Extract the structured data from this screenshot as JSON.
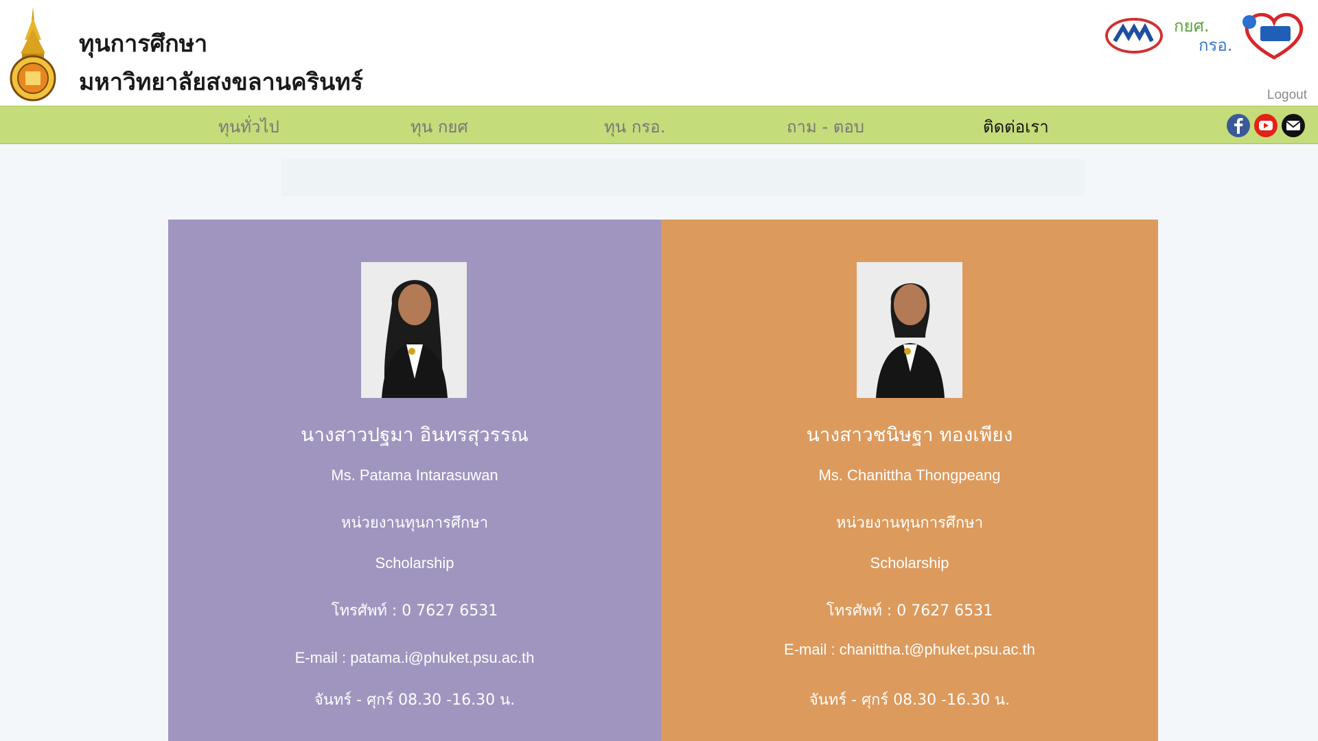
{
  "header": {
    "title_line1": "ทุนการศึกษา",
    "title_line2": "มหาวิทยาลัยสงขลานครินทร์",
    "logout_label": "Logout",
    "partner_text_1": "กยศ.",
    "partner_text_2": "กรอ."
  },
  "nav": {
    "items": [
      {
        "label": "ทุนทั่วไป"
      },
      {
        "label": "ทุน กยศ"
      },
      {
        "label": "ทุน กรอ."
      },
      {
        "label": "ถาม - ตอบ"
      },
      {
        "label": "ติดต่อเรา"
      }
    ],
    "social_icons": [
      "facebook-icon",
      "youtube-icon",
      "email-icon"
    ]
  },
  "contacts": [
    {
      "name_th": "นางสาวปฐมา อินทรสุวรรณ",
      "name_en": "Ms. Patama Intarasuwan",
      "unit_th": "หน่วยงานทุนการศึกษา",
      "unit_en": "Scholarship",
      "phone": "โทรศัพท์ : 0 7627 6531",
      "email": "E-mail : patama.i@phuket.psu.ac.th",
      "hours": "จันทร์ - ศุกร์ 08.30 -16.30 น."
    },
    {
      "name_th": "นางสาวชนิษฐา ทองเพียง",
      "name_en": "Ms. Chanittha Thongpeang",
      "unit_th": "หน่วยงานทุนการศึกษา",
      "unit_en": "Scholarship",
      "phone": "โทรศัพท์ : 0 7627 6531",
      "email": "E-mail : chanittha.t@phuket.psu.ac.th",
      "hours": "จันทร์ - ศุกร์ 08.30 -16.30 น."
    }
  ],
  "colors": {
    "nav_bg": "#c5dc7a",
    "card_purple": "#a095bf",
    "card_orange": "#dc9a5d"
  }
}
